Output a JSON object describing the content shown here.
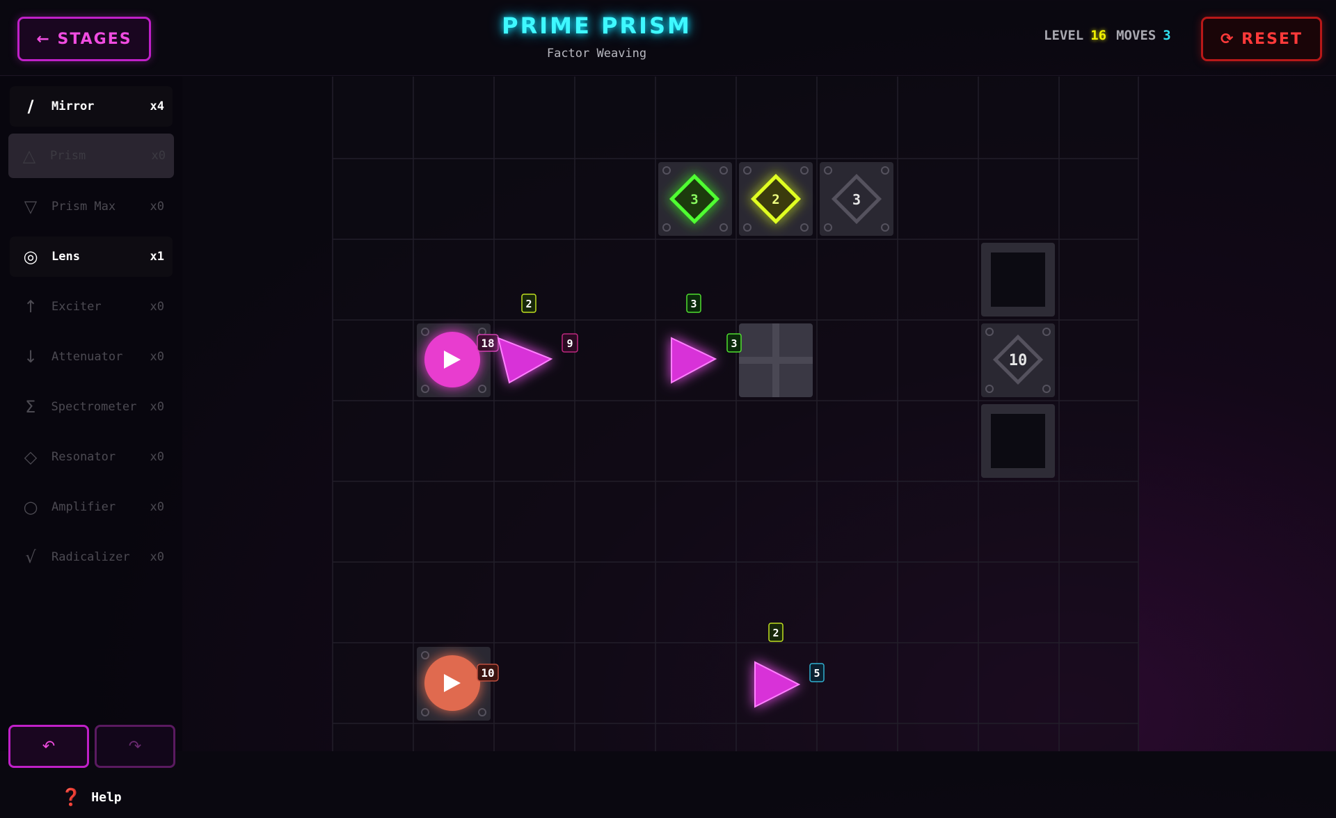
{
  "header": {
    "back_label": "← STAGES",
    "title": "PRIME PRISM",
    "subtitle": "Factor Weaving",
    "level_label": "LEVEL",
    "level_value": "16",
    "moves_label": "MOVES",
    "moves_value": "3",
    "reset_label": "⟳ RESET"
  },
  "sidebar": {
    "tools": [
      {
        "icon": "/",
        "name": "Mirror",
        "count": "x4"
      },
      {
        "icon": "△",
        "name": "Prism",
        "count": "x0"
      },
      {
        "icon": "▽",
        "name": "Prism Max",
        "count": "x0"
      },
      {
        "icon": "◎",
        "name": "Lens",
        "count": "x1"
      },
      {
        "icon": "↑",
        "name": "Exciter",
        "count": "x0"
      },
      {
        "icon": "↓",
        "name": "Attenuator",
        "count": "x0"
      },
      {
        "icon": "Σ",
        "name": "Spectrometer",
        "count": "x0"
      },
      {
        "icon": "◇",
        "name": "Resonator",
        "count": "x0"
      },
      {
        "icon": "○",
        "name": "Amplifier",
        "count": "x0"
      },
      {
        "icon": "√",
        "name": "Radicalizer",
        "count": "x0"
      }
    ],
    "undo_label": "↶",
    "redo_label": "↷",
    "help_icon": "❓",
    "help_label": "Help"
  },
  "colors": {
    "accent_magenta": "#e030e0",
    "accent_cyan": "#30f0ff",
    "beam_green": "#70ff40",
    "beam_yellow": "#d8ff30",
    "beam_pink": "#ff70d0",
    "beam_salmon": "#ff8a70",
    "beam_blue": "#40c8f0",
    "reset_red": "#ff3a3a"
  },
  "board": {
    "sources": [
      {
        "value": "18",
        "color": "#e83ccf"
      },
      {
        "value": "10",
        "color": "#e06a50"
      }
    ],
    "targets": [
      {
        "value": "3",
        "state": "satisfied",
        "color": "#50ff30"
      },
      {
        "value": "2",
        "state": "satisfied",
        "color": "#e0ff20"
      },
      {
        "value": "3",
        "state": "inactive"
      },
      {
        "value": "10",
        "state": "inactive"
      }
    ],
    "beam_labels": [
      "2",
      "9",
      "3",
      "3",
      "2",
      "5"
    ]
  }
}
